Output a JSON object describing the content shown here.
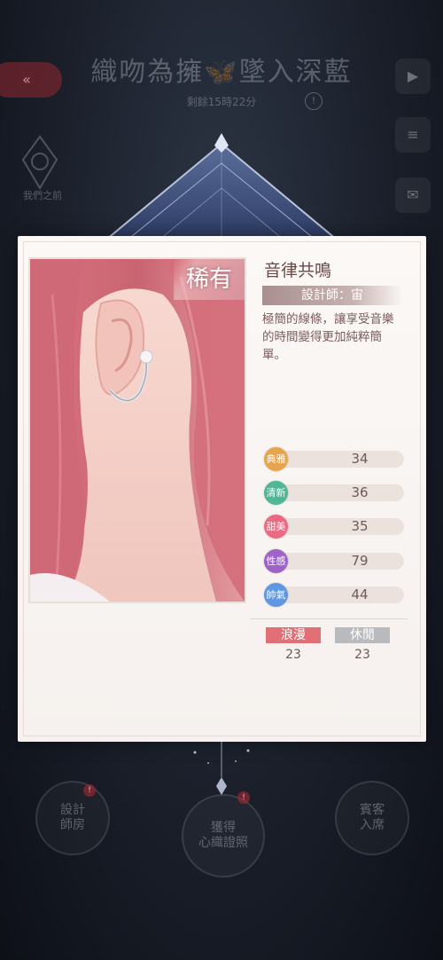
{
  "background": {
    "event_title": "織吻為擁🦋墜入深藍",
    "subtitle": "剩餘15時22分",
    "info_icon": "!",
    "back_label": "«",
    "left_emblem_label": "我們之前",
    "side_icons": [
      "▶",
      "≡",
      "✉"
    ],
    "bottom_buttons": [
      {
        "label": "設計\n師房",
        "badge": "!"
      },
      {
        "label": "獲得\n心織證照",
        "badge": "!"
      },
      {
        "label": "賓客\n入席",
        "badge": ""
      }
    ]
  },
  "card": {
    "rarity": "稀有",
    "item_name": "音律共鳴",
    "designer": "設計師：宙",
    "description": "極簡的線條，讓享受音樂的時間變得更加純粹簡單。",
    "stats": [
      {
        "label": "典雅",
        "value": "34",
        "color": "#e7a44f"
      },
      {
        "label": "清新",
        "value": "36",
        "color": "#4fb696"
      },
      {
        "label": "甜美",
        "value": "35",
        "color": "#ea6a83"
      },
      {
        "label": "性感",
        "value": "79",
        "color": "#9f63c8"
      },
      {
        "label": "帥氣",
        "value": "44",
        "color": "#5e97e3"
      }
    ],
    "tags": [
      {
        "label": "浪漫",
        "value": "23",
        "color": "#e06f76"
      },
      {
        "label": "休閒",
        "value": "23",
        "color": "#b9babd"
      }
    ]
  }
}
